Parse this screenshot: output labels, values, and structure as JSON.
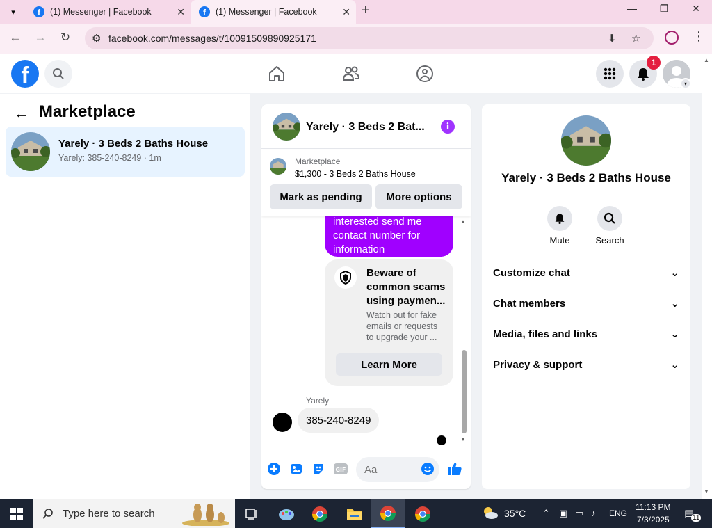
{
  "browser": {
    "tabs": [
      {
        "title": "(1) Messenger | Facebook",
        "active": false
      },
      {
        "title": "(1) Messenger | Facebook",
        "active": true
      }
    ],
    "url": "facebook.com/messages/t/10091509890925171"
  },
  "fb_header": {
    "notification_count": "1"
  },
  "left_panel": {
    "title": "Marketplace",
    "conversation": {
      "name": "Yarely · 3 Beds 2 Baths House",
      "preview": "Yarely: 385-240-8249 · 1m"
    }
  },
  "chat": {
    "title": "Yarely · 3 Beds 2 Bat...",
    "marketplace_label": "Marketplace",
    "listing": "$1,300 - 3 Beds 2 Baths House",
    "mark_pending": "Mark as pending",
    "more_options": "More options",
    "outgoing_message": "interested send me contact number for information",
    "scam_title": "Beware of common scams using paymen...",
    "scam_body": "Watch out for fake emails or requests to upgrade your ...",
    "learn_more": "Learn More",
    "sender": "Yarely",
    "incoming_message": "385-240-8249",
    "input_placeholder": "Aa"
  },
  "info_panel": {
    "title": "Yarely · 3 Beds 2 Baths House",
    "actions": [
      {
        "label": "Mute",
        "icon": "bell-icon"
      },
      {
        "label": "Search",
        "icon": "search-icon"
      }
    ],
    "sections": [
      "Customize chat",
      "Chat members",
      "Media, files and links",
      "Privacy & support"
    ]
  },
  "taskbar": {
    "search_placeholder": "Type here to search",
    "temperature": "35°C",
    "language": "ENG",
    "time": "11:13 PM",
    "date": "7/3/2025",
    "notification_count": "11"
  },
  "colors": {
    "fb_blue": "#1877f2",
    "messenger_purple": "#a000ff",
    "tab_bar": "#f6d9e9"
  }
}
